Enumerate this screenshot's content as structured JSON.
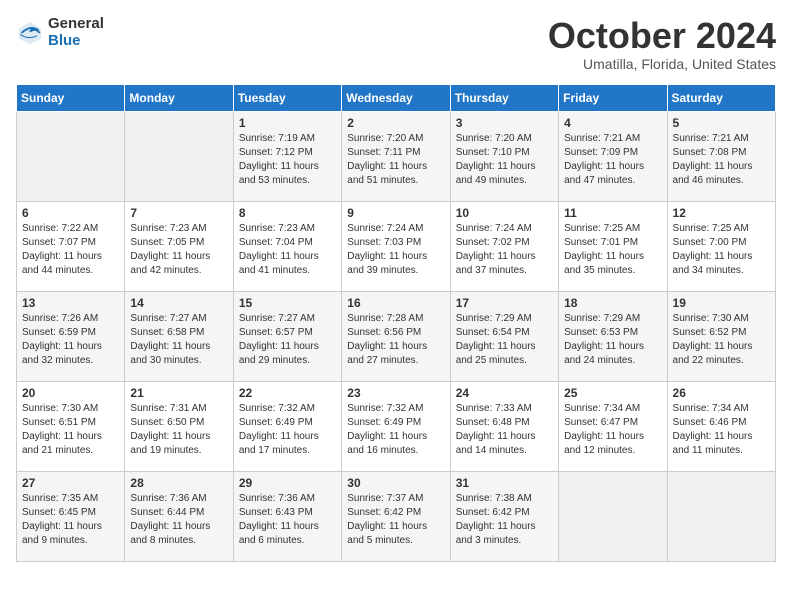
{
  "header": {
    "logo_general": "General",
    "logo_blue": "Blue",
    "month_title": "October 2024",
    "location": "Umatilla, Florida, United States"
  },
  "days_of_week": [
    "Sunday",
    "Monday",
    "Tuesday",
    "Wednesday",
    "Thursday",
    "Friday",
    "Saturday"
  ],
  "weeks": [
    [
      {
        "day": "",
        "sunrise": "",
        "sunset": "",
        "daylight": "",
        "empty": true
      },
      {
        "day": "",
        "sunrise": "",
        "sunset": "",
        "daylight": "",
        "empty": true
      },
      {
        "day": "1",
        "sunrise": "Sunrise: 7:19 AM",
        "sunset": "Sunset: 7:12 PM",
        "daylight": "Daylight: 11 hours and 53 minutes."
      },
      {
        "day": "2",
        "sunrise": "Sunrise: 7:20 AM",
        "sunset": "Sunset: 7:11 PM",
        "daylight": "Daylight: 11 hours and 51 minutes."
      },
      {
        "day": "3",
        "sunrise": "Sunrise: 7:20 AM",
        "sunset": "Sunset: 7:10 PM",
        "daylight": "Daylight: 11 hours and 49 minutes."
      },
      {
        "day": "4",
        "sunrise": "Sunrise: 7:21 AM",
        "sunset": "Sunset: 7:09 PM",
        "daylight": "Daylight: 11 hours and 47 minutes."
      },
      {
        "day": "5",
        "sunrise": "Sunrise: 7:21 AM",
        "sunset": "Sunset: 7:08 PM",
        "daylight": "Daylight: 11 hours and 46 minutes."
      }
    ],
    [
      {
        "day": "6",
        "sunrise": "Sunrise: 7:22 AM",
        "sunset": "Sunset: 7:07 PM",
        "daylight": "Daylight: 11 hours and 44 minutes."
      },
      {
        "day": "7",
        "sunrise": "Sunrise: 7:23 AM",
        "sunset": "Sunset: 7:05 PM",
        "daylight": "Daylight: 11 hours and 42 minutes."
      },
      {
        "day": "8",
        "sunrise": "Sunrise: 7:23 AM",
        "sunset": "Sunset: 7:04 PM",
        "daylight": "Daylight: 11 hours and 41 minutes."
      },
      {
        "day": "9",
        "sunrise": "Sunrise: 7:24 AM",
        "sunset": "Sunset: 7:03 PM",
        "daylight": "Daylight: 11 hours and 39 minutes."
      },
      {
        "day": "10",
        "sunrise": "Sunrise: 7:24 AM",
        "sunset": "Sunset: 7:02 PM",
        "daylight": "Daylight: 11 hours and 37 minutes."
      },
      {
        "day": "11",
        "sunrise": "Sunrise: 7:25 AM",
        "sunset": "Sunset: 7:01 PM",
        "daylight": "Daylight: 11 hours and 35 minutes."
      },
      {
        "day": "12",
        "sunrise": "Sunrise: 7:25 AM",
        "sunset": "Sunset: 7:00 PM",
        "daylight": "Daylight: 11 hours and 34 minutes."
      }
    ],
    [
      {
        "day": "13",
        "sunrise": "Sunrise: 7:26 AM",
        "sunset": "Sunset: 6:59 PM",
        "daylight": "Daylight: 11 hours and 32 minutes."
      },
      {
        "day": "14",
        "sunrise": "Sunrise: 7:27 AM",
        "sunset": "Sunset: 6:58 PM",
        "daylight": "Daylight: 11 hours and 30 minutes."
      },
      {
        "day": "15",
        "sunrise": "Sunrise: 7:27 AM",
        "sunset": "Sunset: 6:57 PM",
        "daylight": "Daylight: 11 hours and 29 minutes."
      },
      {
        "day": "16",
        "sunrise": "Sunrise: 7:28 AM",
        "sunset": "Sunset: 6:56 PM",
        "daylight": "Daylight: 11 hours and 27 minutes."
      },
      {
        "day": "17",
        "sunrise": "Sunrise: 7:29 AM",
        "sunset": "Sunset: 6:54 PM",
        "daylight": "Daylight: 11 hours and 25 minutes."
      },
      {
        "day": "18",
        "sunrise": "Sunrise: 7:29 AM",
        "sunset": "Sunset: 6:53 PM",
        "daylight": "Daylight: 11 hours and 24 minutes."
      },
      {
        "day": "19",
        "sunrise": "Sunrise: 7:30 AM",
        "sunset": "Sunset: 6:52 PM",
        "daylight": "Daylight: 11 hours and 22 minutes."
      }
    ],
    [
      {
        "day": "20",
        "sunrise": "Sunrise: 7:30 AM",
        "sunset": "Sunset: 6:51 PM",
        "daylight": "Daylight: 11 hours and 21 minutes."
      },
      {
        "day": "21",
        "sunrise": "Sunrise: 7:31 AM",
        "sunset": "Sunset: 6:50 PM",
        "daylight": "Daylight: 11 hours and 19 minutes."
      },
      {
        "day": "22",
        "sunrise": "Sunrise: 7:32 AM",
        "sunset": "Sunset: 6:49 PM",
        "daylight": "Daylight: 11 hours and 17 minutes."
      },
      {
        "day": "23",
        "sunrise": "Sunrise: 7:32 AM",
        "sunset": "Sunset: 6:49 PM",
        "daylight": "Daylight: 11 hours and 16 minutes."
      },
      {
        "day": "24",
        "sunrise": "Sunrise: 7:33 AM",
        "sunset": "Sunset: 6:48 PM",
        "daylight": "Daylight: 11 hours and 14 minutes."
      },
      {
        "day": "25",
        "sunrise": "Sunrise: 7:34 AM",
        "sunset": "Sunset: 6:47 PM",
        "daylight": "Daylight: 11 hours and 12 minutes."
      },
      {
        "day": "26",
        "sunrise": "Sunrise: 7:34 AM",
        "sunset": "Sunset: 6:46 PM",
        "daylight": "Daylight: 11 hours and 11 minutes."
      }
    ],
    [
      {
        "day": "27",
        "sunrise": "Sunrise: 7:35 AM",
        "sunset": "Sunset: 6:45 PM",
        "daylight": "Daylight: 11 hours and 9 minutes."
      },
      {
        "day": "28",
        "sunrise": "Sunrise: 7:36 AM",
        "sunset": "Sunset: 6:44 PM",
        "daylight": "Daylight: 11 hours and 8 minutes."
      },
      {
        "day": "29",
        "sunrise": "Sunrise: 7:36 AM",
        "sunset": "Sunset: 6:43 PM",
        "daylight": "Daylight: 11 hours and 6 minutes."
      },
      {
        "day": "30",
        "sunrise": "Sunrise: 7:37 AM",
        "sunset": "Sunset: 6:42 PM",
        "daylight": "Daylight: 11 hours and 5 minutes."
      },
      {
        "day": "31",
        "sunrise": "Sunrise: 7:38 AM",
        "sunset": "Sunset: 6:42 PM",
        "daylight": "Daylight: 11 hours and 3 minutes."
      },
      {
        "day": "",
        "sunrise": "",
        "sunset": "",
        "daylight": "",
        "empty": true
      },
      {
        "day": "",
        "sunrise": "",
        "sunset": "",
        "daylight": "",
        "empty": true
      }
    ]
  ]
}
